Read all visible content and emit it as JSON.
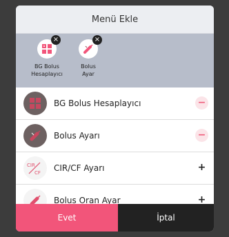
{
  "dialog": {
    "title": "Menü Ekle",
    "selected": [
      {
        "label_line1": "BG Bolus",
        "label_line2": "Hesaplayıcı",
        "icon": "grid-icon",
        "remove": "×"
      },
      {
        "label_line1": "Bolus",
        "label_line2": "Ayar",
        "icon": "syringe-icon",
        "remove": "×"
      }
    ],
    "items": [
      {
        "label": "BG Bolus Hesaplayıcı",
        "icon": "grid-icon",
        "action": "−",
        "state": "added"
      },
      {
        "label": "Bolus Ayarı",
        "icon": "syringe-icon",
        "action": "−",
        "state": "added"
      },
      {
        "label": "CIR/CF Ayarı",
        "icon": "cir-cf-icon",
        "icon_text_top": "CIR",
        "icon_text_bottom": "CF",
        "action": "+",
        "state": "available"
      },
      {
        "label": "Bolus Oran Ayar",
        "icon": "syringe-rate-icon",
        "action": "+",
        "state": "available"
      }
    ],
    "buttons": {
      "confirm": "Evet",
      "cancel": "İptal"
    }
  },
  "colors": {
    "accent": "#f2557a",
    "strip": "#b7bdca",
    "dark_icon_bg": "#6d6161"
  }
}
